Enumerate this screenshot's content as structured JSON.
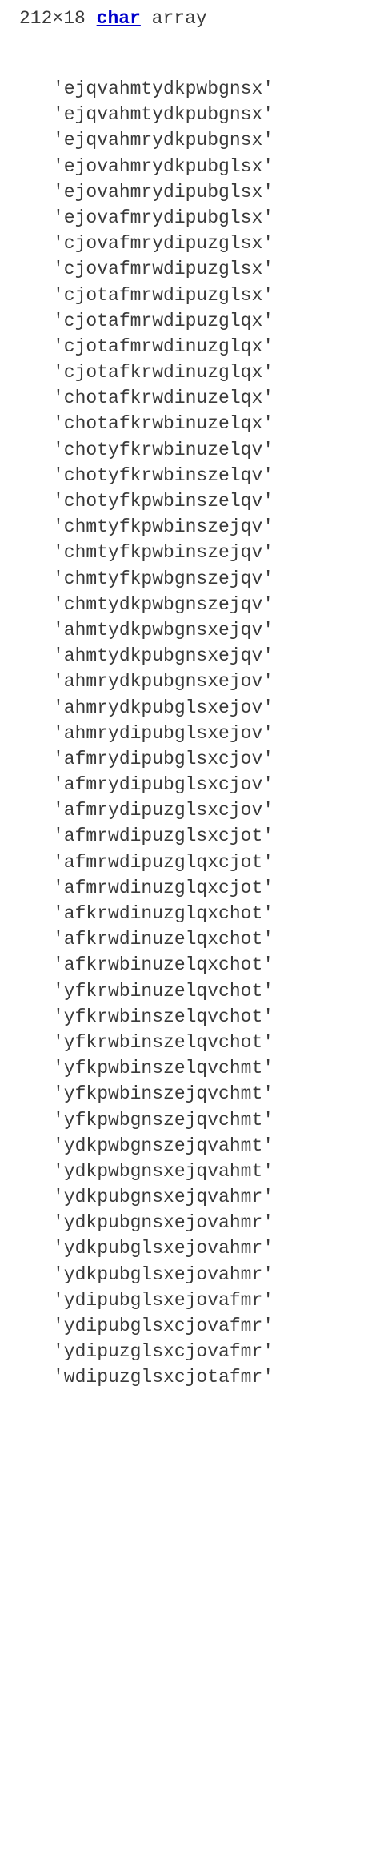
{
  "header": {
    "size": "212×18",
    "type": "char",
    "suffix": "array"
  },
  "rows": [
    "'ejqvahmtydkpwbgnsx'",
    "'ejqvahmtydkpubgnsx'",
    "'ejqvahmrydkpubgnsx'",
    "'ejovahmrydkpubglsx'",
    "'ejovahmrydipubglsx'",
    "'ejovafmrydipubglsx'",
    "'cjovafmrydipuzglsx'",
    "'cjovafmrwdipuzglsx'",
    "'cjotafmrwdipuzglsx'",
    "'cjotafmrwdipuzglqx'",
    "'cjotafmrwdinuzglqx'",
    "'cjotafkrwdinuzglqx'",
    "'chotafkrwdinuzelqx'",
    "'chotafkrwbinuzelqx'",
    "'chotyfkrwbinuzelqv'",
    "'chotyfkrwbinszelqv'",
    "'chotyfkpwbinszelqv'",
    "'chmtyfkpwbinszejqv'",
    "'chmtyfkpwbinszejqv'",
    "'chmtyfkpwbgnszejqv'",
    "'chmtydkpwbgnszejqv'",
    "'ahmtydkpwbgnsxejqv'",
    "'ahmtydkpubgnsxejqv'",
    "'ahmrydkpubgnsxejov'",
    "'ahmrydkpubglsxejov'",
    "'ahmrydipubglsxejov'",
    "'afmrydipubglsxcjov'",
    "'afmrydipubglsxcjov'",
    "'afmrydipuzglsxcjov'",
    "'afmrwdipuzglsxcjot'",
    "'afmrwdipuzglqxcjot'",
    "'afmrwdinuzglqxcjot'",
    "'afkrwdinuzglqxchot'",
    "'afkrwdinuzelqxchot'",
    "'afkrwbinuzelqxchot'",
    "'yfkrwbinuzelqvchot'",
    "'yfkrwbinszelqvchot'",
    "'yfkrwbinszelqvchot'",
    "'yfkpwbinszelqvchmt'",
    "'yfkpwbinszejqvchmt'",
    "'yfkpwbgnszejqvchmt'",
    "'ydkpwbgnszejqvahmt'",
    "'ydkpwbgnsxejqvahmt'",
    "'ydkpubgnsxejqvahmr'",
    "'ydkpubgnsxejovahmr'",
    "'ydkpubglsxejovahmr'",
    "'ydkpubglsxejovahmr'",
    "'ydipubglsxejovafmr'",
    "'ydipubglsxcjovafmr'",
    "'ydipuzglsxcjovafmr'",
    "'wdipuzglsxcjotafmr'"
  ]
}
